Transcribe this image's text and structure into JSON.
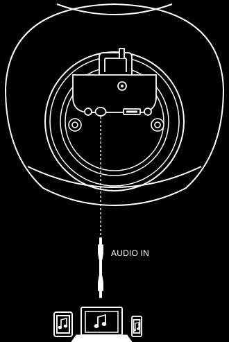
{
  "diagram": {
    "connection_label": "AUDIO IN",
    "colors": {
      "background": "#000000",
      "line": "#ffffff"
    },
    "devices": [
      {
        "name": "tablet-device",
        "icon": "music-note-icon"
      },
      {
        "name": "laptop-device",
        "icon": "music-note-icon"
      },
      {
        "name": "phone-device",
        "icon": "music-note-icon"
      }
    ]
  }
}
